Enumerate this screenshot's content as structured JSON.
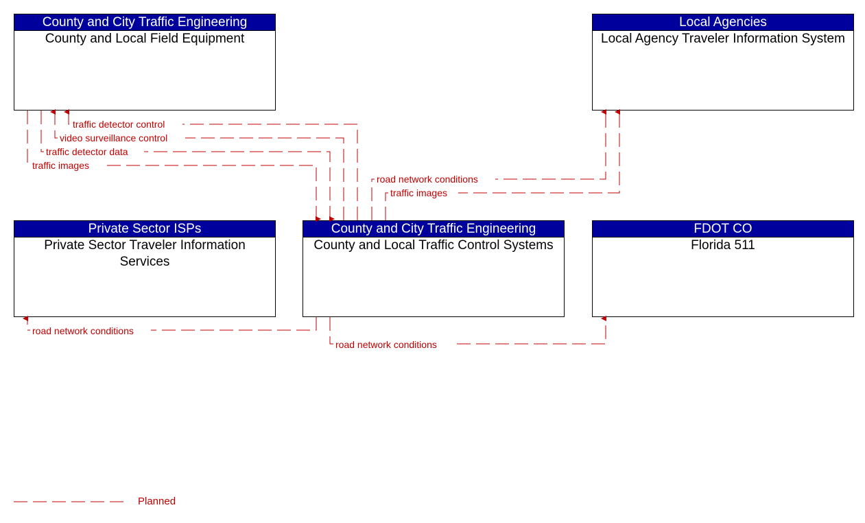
{
  "elements": {
    "field_equipment": {
      "owner": "County and City Traffic Engineering",
      "name": "County and Local Field Equipment"
    },
    "local_agency_tis": {
      "owner": "Local Agencies",
      "name": "Local Agency Traveler Information System"
    },
    "private_isp": {
      "owner": "Private Sector ISPs",
      "name": "Private Sector Traveler Information Services"
    },
    "traffic_control": {
      "owner": "County and City Traffic Engineering",
      "name": "County and Local Traffic Control Systems"
    },
    "florida_511": {
      "owner": "FDOT CO",
      "name": "Florida 511"
    }
  },
  "flows": [
    {
      "label": "traffic detector control",
      "from": "traffic_control",
      "to": "field_equipment",
      "status": "Planned"
    },
    {
      "label": "video surveillance control",
      "from": "traffic_control",
      "to": "field_equipment",
      "status": "Planned"
    },
    {
      "label": "traffic detector data",
      "from": "field_equipment",
      "to": "traffic_control",
      "status": "Planned"
    },
    {
      "label": "traffic images",
      "from": "field_equipment",
      "to": "traffic_control",
      "status": "Planned"
    },
    {
      "label": "road network conditions",
      "from": "traffic_control",
      "to": "local_agency_tis",
      "status": "Planned"
    },
    {
      "label": "traffic images",
      "from": "traffic_control",
      "to": "local_agency_tis",
      "status": "Planned"
    },
    {
      "label": "road network conditions",
      "from": "traffic_control",
      "to": "private_isp",
      "status": "Planned"
    },
    {
      "label": "road network conditions",
      "from": "traffic_control",
      "to": "florida_511",
      "status": "Planned"
    }
  ],
  "legend": {
    "planned_label": "Planned",
    "line_color": "#c00000"
  },
  "colors": {
    "header_bg": "#00009c",
    "flow": "#c00000"
  }
}
